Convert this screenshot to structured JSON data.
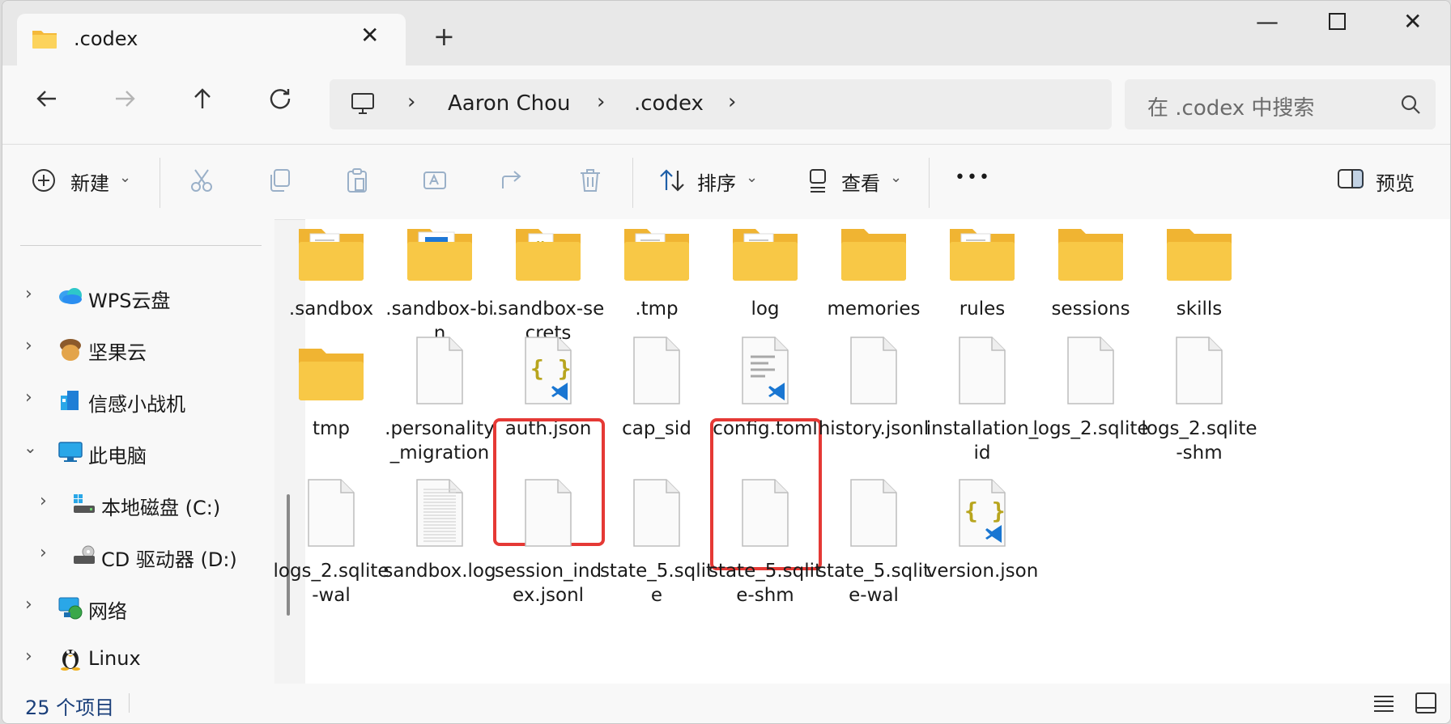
{
  "window": {
    "tab_title": ".codex",
    "new_tab_symbol": "+",
    "controls": [
      "minimize",
      "maximize",
      "close"
    ]
  },
  "nav": {
    "breadcrumb": [
      "Aaron Chou",
      ".codex"
    ],
    "search_placeholder": "在 .codex 中搜索"
  },
  "toolbar": {
    "new_label": "新建",
    "sort_label": "排序",
    "view_label": "查看",
    "more_label": "•••",
    "preview_label": "预览"
  },
  "sidebar": {
    "items": [
      {
        "label": "WPS云盘",
        "expanded": false
      },
      {
        "label": "坚果云",
        "expanded": false
      },
      {
        "label": "信感小战机",
        "expanded": false
      },
      {
        "label": "此电脑",
        "expanded": true
      },
      {
        "label": "本地磁盘 (C:)",
        "expanded": false
      },
      {
        "label": "CD 驱动器 (D:)",
        "expanded": false
      },
      {
        "label": "网络",
        "expanded": false
      },
      {
        "label": "Linux",
        "expanded": false
      }
    ]
  },
  "files": [
    {
      "name": ".sandbox",
      "kind": "folder-doc"
    },
    {
      "name": ".sandbox-bin",
      "kind": "folder-app"
    },
    {
      "name": ".sandbox-secrets",
      "kind": "folder-json"
    },
    {
      "name": ".tmp",
      "kind": "folder-doc"
    },
    {
      "name": "log",
      "kind": "folder-doc"
    },
    {
      "name": "memories",
      "kind": "folder"
    },
    {
      "name": "rules",
      "kind": "folder-doc"
    },
    {
      "name": "sessions",
      "kind": "folder"
    },
    {
      "name": "skills",
      "kind": "folder"
    },
    {
      "name": "tmp",
      "kind": "folder"
    },
    {
      "name": ".personality_migration",
      "kind": "file"
    },
    {
      "name": "auth.json",
      "kind": "json",
      "highlighted": true
    },
    {
      "name": "cap_sid",
      "kind": "file"
    },
    {
      "name": "config.toml",
      "kind": "text-vscode",
      "highlighted": true
    },
    {
      "name": "history.jsonl",
      "kind": "file"
    },
    {
      "name": "installation_id",
      "kind": "file"
    },
    {
      "name": "logs_2.sqlite",
      "kind": "file"
    },
    {
      "name": "logs_2.sqlite-shm",
      "kind": "file"
    },
    {
      "name": "logs_2.sqlite-wal",
      "kind": "file"
    },
    {
      "name": "sandbox.log",
      "kind": "lined"
    },
    {
      "name": "session_index.jsonl",
      "kind": "file"
    },
    {
      "name": "state_5.sqlite",
      "kind": "file"
    },
    {
      "name": "state_5.sqlite-shm",
      "kind": "file"
    },
    {
      "name": "state_5.sqlite-wal",
      "kind": "file"
    },
    {
      "name": "version.json",
      "kind": "json"
    }
  ],
  "status": {
    "item_count": "25 个项目"
  },
  "colors": {
    "folder": "#f8c846",
    "highlight": "#e53935",
    "json_braces": "#b8a51e",
    "vscode_blue": "#1976d2"
  }
}
